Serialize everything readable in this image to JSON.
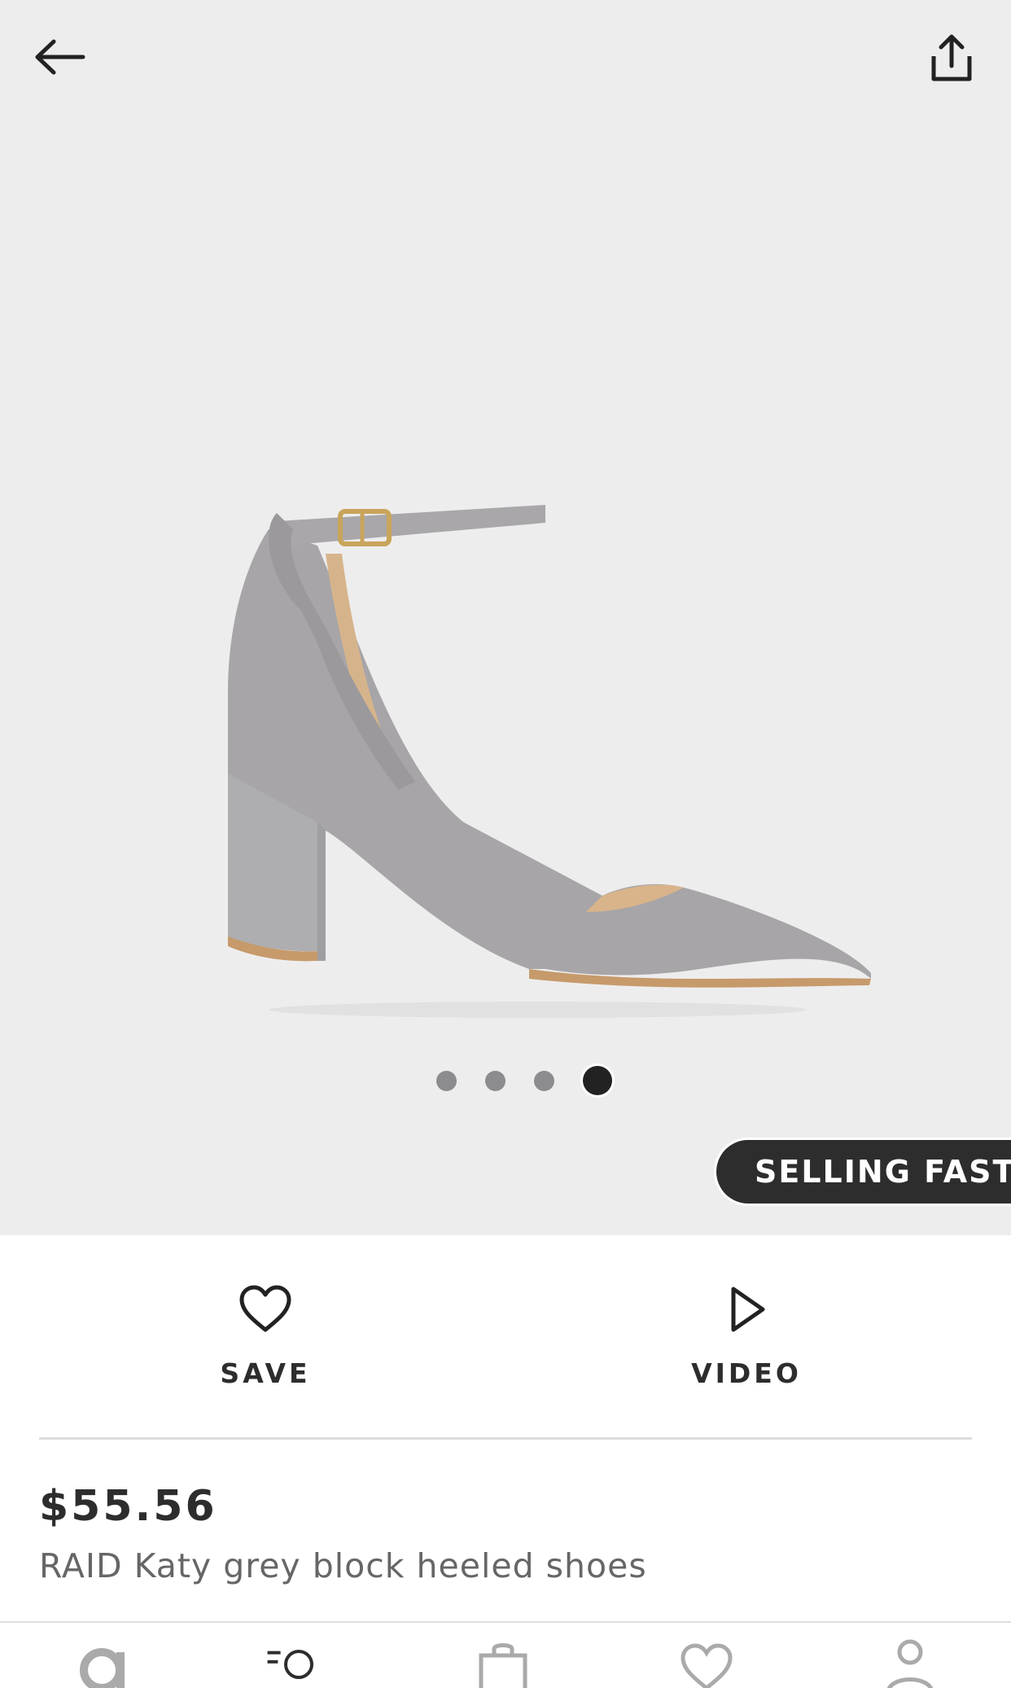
{
  "colors": {
    "hero_bg": "#eeedee",
    "text_dark": "#2d2d2d",
    "text_muted": "#666666",
    "badge_bg": "#2d2d2d"
  },
  "header": {
    "back_icon": "arrow-left-icon",
    "share_icon": "share-icon"
  },
  "gallery": {
    "image_count": 4,
    "active_index": 4
  },
  "badge": {
    "label": "SELLING FAST"
  },
  "actions": {
    "save": {
      "label": "SAVE",
      "icon": "heart-icon"
    },
    "video": {
      "label": "VIDEO",
      "icon": "play-icon"
    }
  },
  "product": {
    "price": "$55.56",
    "title": "RAID Katy grey block heeled shoes"
  },
  "tabbar": {
    "icons": [
      "home-icon",
      "search-icon",
      "bag-icon",
      "saved-icon",
      "account-icon"
    ]
  }
}
